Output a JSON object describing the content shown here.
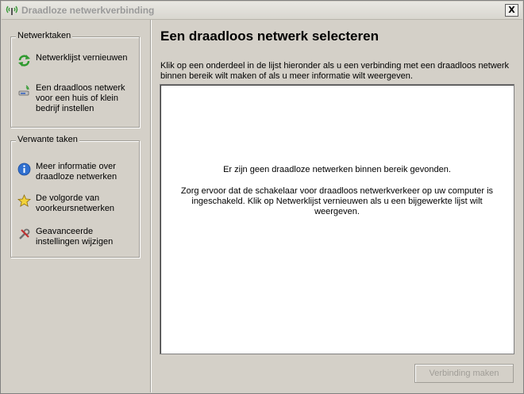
{
  "window": {
    "title": "Draadloze netwerkverbinding",
    "close_label": "X"
  },
  "sidebar": {
    "network_tasks": {
      "title": "Netwerktaken",
      "items": [
        {
          "label": "Netwerklijst vernieuwen",
          "icon": "refresh-icon"
        },
        {
          "label": "Een draadloos netwerk voor een huis of klein bedrijf instellen",
          "icon": "wireless-setup-icon"
        }
      ]
    },
    "related_tasks": {
      "title": "Verwante taken",
      "items": [
        {
          "label": "Meer informatie over draadloze netwerken",
          "icon": "info-icon"
        },
        {
          "label": "De volgorde van voorkeursnetwerken",
          "icon": "star-icon"
        },
        {
          "label": "Geavanceerde instellingen wijzigen",
          "icon": "settings-tools-icon"
        }
      ]
    }
  },
  "main": {
    "heading": "Een draadloos netwerk selecteren",
    "instruction": "Klik op een onderdeel in de lijst hieronder als u een verbinding met een draadloos netwerk binnen bereik wilt maken of als u meer informatie wilt weergeven.",
    "empty_message": "Er zijn geen draadloze netwerken binnen bereik gevonden.",
    "hint": "Zorg ervoor dat de schakelaar voor draadloos netwerkverkeer op uw computer is ingeschakeld. Klik op Netwerklijst vernieuwen als u een bijgewerkte lijst wilt weergeven.",
    "connect_button": "Verbinding maken"
  }
}
